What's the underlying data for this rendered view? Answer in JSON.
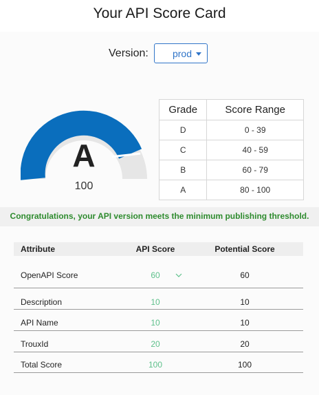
{
  "page": {
    "title": "Your API Score Card"
  },
  "version": {
    "label": "Version:",
    "selected": "prod"
  },
  "gauge": {
    "grade": "A",
    "score": "100",
    "fill_percent": 100
  },
  "grade_table": {
    "headers": [
      "Grade",
      "Score Range"
    ],
    "rows": [
      {
        "grade": "D",
        "range": "0 - 39"
      },
      {
        "grade": "C",
        "range": "40 - 59"
      },
      {
        "grade": "B",
        "range": "60 - 79"
      },
      {
        "grade": "A",
        "range": "80 - 100"
      }
    ]
  },
  "banner": {
    "message": "Congratulations, your API version meets the minimum publishing threshold."
  },
  "attributes": {
    "headers": [
      "Attribute",
      "API Score",
      "Potential Score"
    ],
    "rows": [
      {
        "name": "OpenAPI Score",
        "score": "60",
        "potential": "60",
        "expandable": true
      },
      {
        "name": "Description",
        "score": "10",
        "potential": "10"
      },
      {
        "name": "API Name",
        "score": "10",
        "potential": "10"
      },
      {
        "name": "TrouxId",
        "score": "20",
        "potential": "20"
      },
      {
        "name": "Total Score",
        "score": "100",
        "potential": "100"
      }
    ]
  },
  "colors": {
    "accent": "#0a6ebd",
    "select_border": "#2f74c8",
    "success_text": "#2e8b2e",
    "score_text": "#5ec08b"
  },
  "icons": {
    "version_dropdown": "caret-down-icon",
    "expand_row": "chevron-down-icon"
  }
}
